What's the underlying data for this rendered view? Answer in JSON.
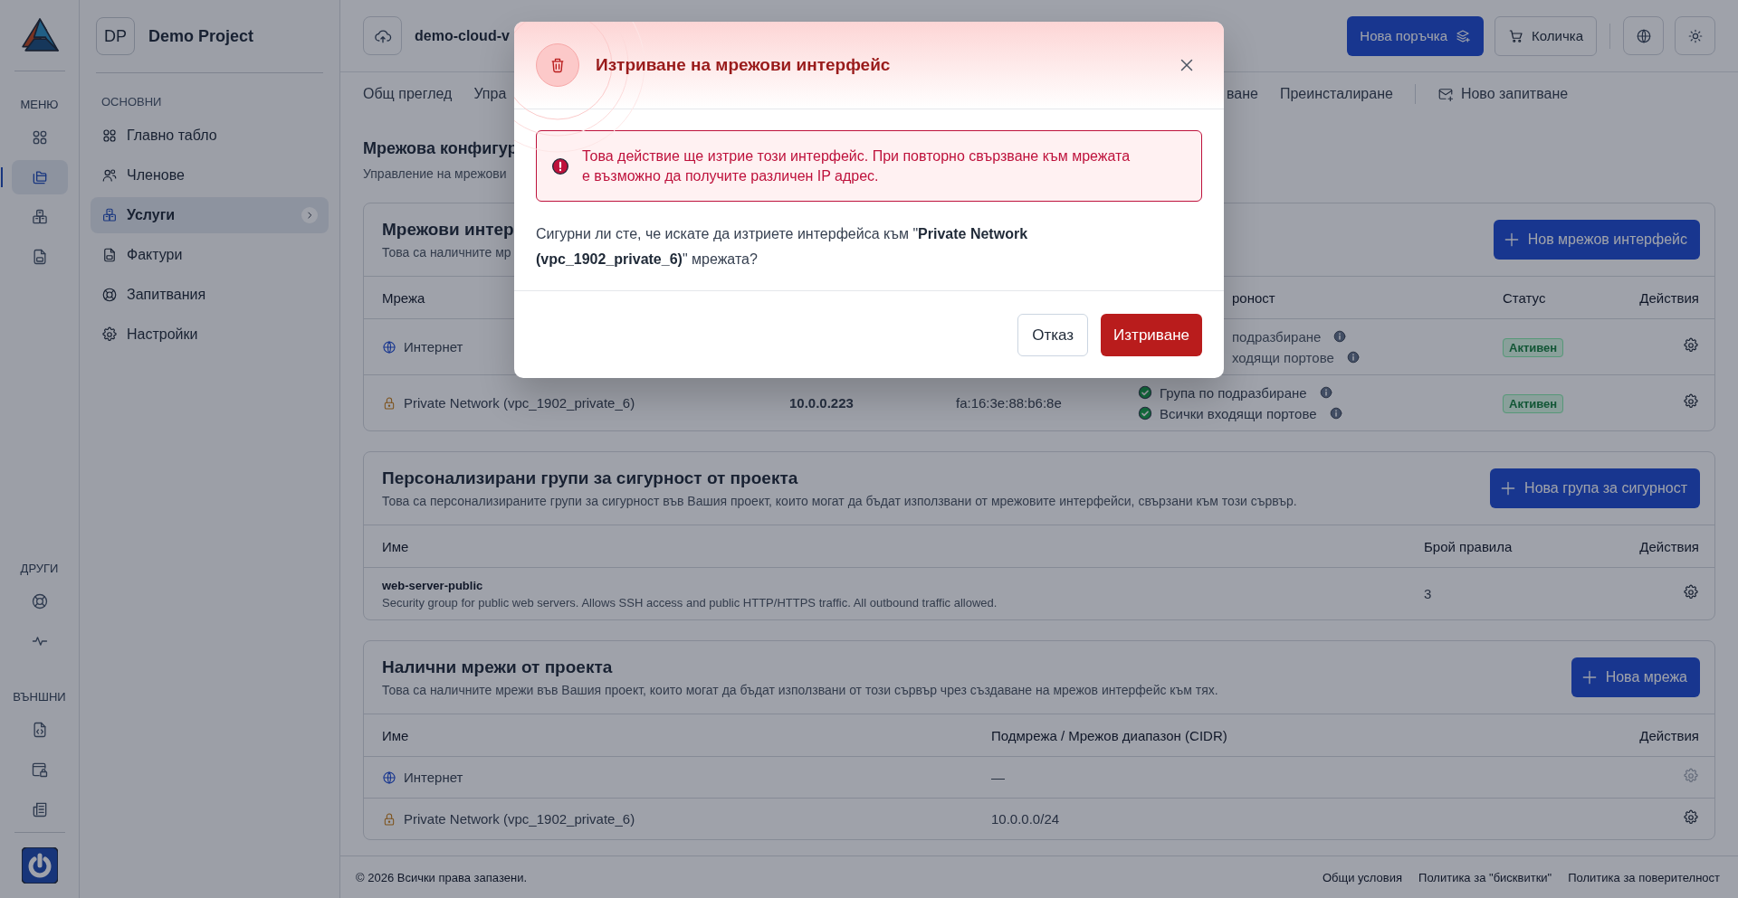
{
  "rail": {
    "sections": [
      {
        "label": "МЕНЮ",
        "items": [
          {
            "selected": false
          },
          {
            "selected": true
          },
          {
            "selected": false
          },
          {
            "selected": false
          }
        ]
      },
      {
        "label": "ДРУГИ",
        "items": [
          {
            "selected": false
          },
          {
            "selected": false
          }
        ]
      },
      {
        "label": "ВЪНШНИ",
        "items": [
          {
            "selected": false
          },
          {
            "selected": false
          },
          {
            "selected": false
          }
        ]
      }
    ]
  },
  "project": {
    "initials": "DP",
    "name": "Demo Project"
  },
  "sidebar": {
    "section": "ОСНОВНИ",
    "items": [
      {
        "label": "Главно табло",
        "selected": false,
        "has_submenu": false
      },
      {
        "label": "Членове",
        "selected": false,
        "has_submenu": false
      },
      {
        "label": "Услуги",
        "selected": true,
        "has_submenu": true
      },
      {
        "label": "Фактури",
        "selected": false,
        "has_submenu": false
      },
      {
        "label": "Запитвания",
        "selected": false,
        "has_submenu": false
      },
      {
        "label": "Настройки",
        "selected": false,
        "has_submenu": false
      }
    ]
  },
  "topbar": {
    "server_name": "demo-cloud-v",
    "order_button": "Нова поръчка",
    "cart_button": "Количка"
  },
  "tabs_left": [
    {
      "label": "Общ преглед",
      "selected": false
    },
    {
      "label": "Упра",
      "selected": false
    }
  ],
  "tabs_right": [
    {
      "label": "ване",
      "selected": false
    },
    {
      "label": "Преинсталиране",
      "selected": false
    }
  ],
  "new_ticket": "Ново запитване",
  "section": {
    "title": "Мрежова конфигур",
    "subtitle": "Управление на мрежови"
  },
  "interfaces": {
    "title": "Мрежови интер",
    "subtitle": "Това са наличните мр",
    "button": "Нов мрежов интерфейс",
    "columns": {
      "column_1": "Мрежа",
      "column_4": "роност",
      "column_5": "Статус",
      "column_6": "Действия"
    },
    "rows": [
      {
        "network": "Интернет",
        "kind": "public",
        "security": [
          {
            "text": "подразбиране",
            "cut": true
          },
          {
            "text": "ходящи портове",
            "cut": true
          }
        ],
        "status": "Активен"
      },
      {
        "network": "Private Network (vpc_1902_private_6)",
        "kind": "private",
        "ip": "10.0.0.223",
        "mac": "fa:16:3e:88:b6:8e",
        "security": [
          {
            "text": "Група по подразбиране",
            "cut": false
          },
          {
            "text": "Всички входящи портове",
            "cut": false
          }
        ],
        "status": "Активен"
      }
    ]
  },
  "groups": {
    "title": "Персонализирани групи за сигурност от проекта",
    "subtitle": "Това са персонализираните групи за сигурност във Вашия проект, които могат да бъдат използвани от мрежовите интерфейси, свързани към този сървър.",
    "button": "Нова група за сигурност",
    "columns": [
      "Име",
      "Брой правила",
      "Действия"
    ],
    "rows": [
      {
        "name": "web-server-public",
        "description": "Security group for public web servers. Allows SSH access and public HTTP/HTTPS traffic. All outbound traffic allowed.",
        "rules": "3"
      }
    ]
  },
  "networks": {
    "title": "Налични мрежи от проекта",
    "subtitle": "Това са наличните мрежи във Вашия проект, които могат да бъдат използвани от този сървър чрез създаване на мрежов интерфейс към тях.",
    "button": "Нова мрежа",
    "columns": [
      "Име",
      "Подмрежа / Мрежов диапазон (CIDR)",
      "Действия"
    ],
    "rows": [
      {
        "name": "Интернет",
        "kind": "public",
        "cidr": "—",
        "disabled": true
      },
      {
        "name": "Private Network (vpc_1902_private_6)",
        "kind": "private",
        "cidr": "10.0.0.0/24",
        "disabled": false
      }
    ]
  },
  "footer": {
    "copyright": "© 2026 Всички права запазени.",
    "links": [
      "Общи условия",
      "Политика за \"бисквитки\"",
      "Политика за поверителност"
    ]
  },
  "dialog": {
    "title": "Изтриване на мрежови интерфейс",
    "warning": "Това действие ще изтрие този интерфейс. При повторно свързване към мрежата е възможно да получите различен IP адрес.",
    "question": "Сигурни ли сте, че искате да изтриете интерфейса към \"**Private Network (vpc_1902_private_6)**\" мрежата?",
    "cancel": "Отказ",
    "confirm": "Изтриване"
  }
}
